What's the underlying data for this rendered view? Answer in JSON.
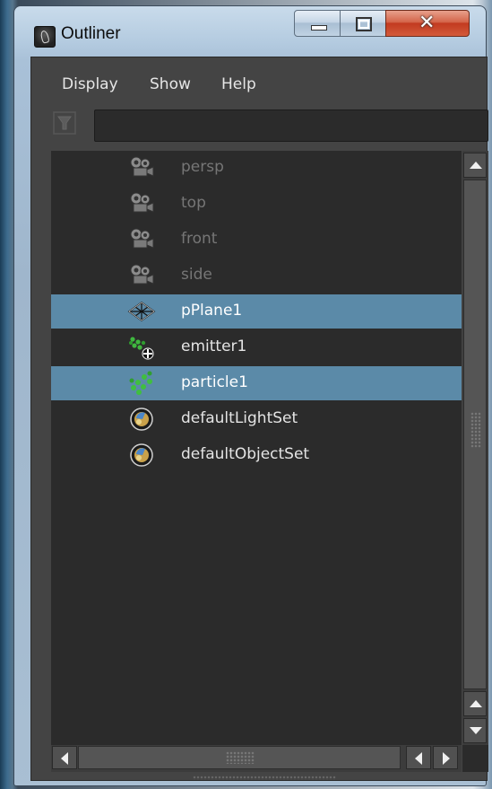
{
  "window": {
    "title": "Outliner",
    "buttons": [
      "minimize",
      "maximize",
      "close"
    ]
  },
  "menubar": {
    "items": [
      {
        "label": "Display"
      },
      {
        "label": "Show"
      },
      {
        "label": "Help"
      }
    ]
  },
  "filter": {
    "value": "",
    "placeholder": ""
  },
  "outliner": {
    "items": [
      {
        "label": "persp",
        "icon": "camera-icon",
        "dimmed": true,
        "selected": false
      },
      {
        "label": "top",
        "icon": "camera-icon",
        "dimmed": true,
        "selected": false
      },
      {
        "label": "front",
        "icon": "camera-icon",
        "dimmed": true,
        "selected": false
      },
      {
        "label": "side",
        "icon": "camera-icon",
        "dimmed": true,
        "selected": false
      },
      {
        "label": "pPlane1",
        "icon": "mesh-plane-icon",
        "dimmed": false,
        "selected": true
      },
      {
        "label": "emitter1",
        "icon": "emitter-icon",
        "dimmed": false,
        "selected": false
      },
      {
        "label": "particle1",
        "icon": "particle-icon",
        "dimmed": false,
        "selected": true
      },
      {
        "label": "defaultLightSet",
        "icon": "set-icon",
        "dimmed": false,
        "selected": false
      },
      {
        "label": "defaultObjectSet",
        "icon": "set-icon",
        "dimmed": false,
        "selected": false
      }
    ]
  },
  "colors": {
    "panel_bg": "#2b2b2b",
    "chrome_bg": "#444444",
    "selection": "#5b8aa8",
    "dim_text": "#767676",
    "text": "#e4e4e4"
  }
}
